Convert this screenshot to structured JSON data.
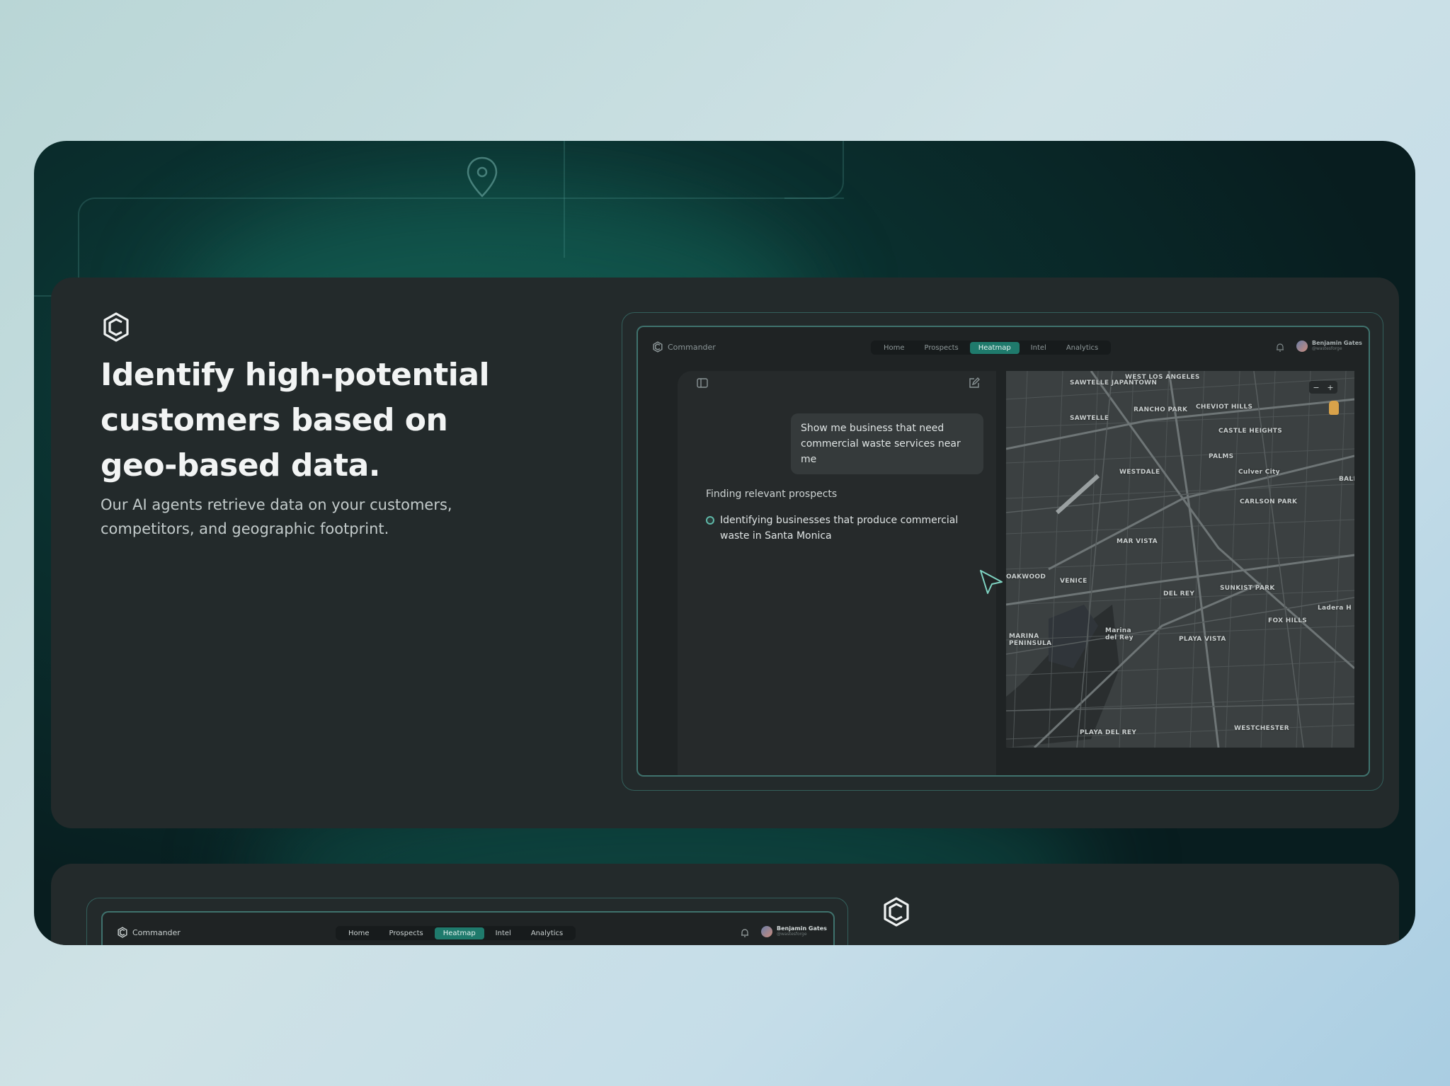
{
  "hero": {
    "headline": "Identify high-potential customers based on geo-based data.",
    "subtext": "Our AI agents retrieve data on your customers, competitors, and geographic footprint."
  },
  "app": {
    "brand": "Commander",
    "nav": [
      {
        "label": "Home",
        "active": false
      },
      {
        "label": "Prospects",
        "active": false
      },
      {
        "label": "Heatmap",
        "active": true
      },
      {
        "label": "Intel",
        "active": false
      },
      {
        "label": "Analytics",
        "active": false
      }
    ],
    "user": {
      "name": "Benjamin Gates",
      "handle": "@wastesforge"
    },
    "accent_color": "#1f7a6c"
  },
  "chat": {
    "user_message": "Show me business that need commercial waste services near me",
    "status_title": "Finding relevant prospects",
    "status_item": "Identifying businesses that produce commercial waste in Santa Monica"
  },
  "map": {
    "zoom_out": "−",
    "zoom_in": "+",
    "labels": [
      "SAWTELLE JAPANTOWN",
      "WEST LOS ANGELES",
      "RANCHO PARK",
      "CHEVIOT HILLS",
      "SAWTELLE",
      "CASTLE HEIGHTS",
      "PALMS",
      "WESTDALE",
      "Culver City",
      "CARLSON PARK",
      "MAR VISTA",
      "OAKWOOD",
      "VENICE",
      "DEL REY",
      "SUNKIST PARK",
      "FOX HILLS",
      "Ladera H",
      "MARINA PENINSULA",
      "Marina del Rey",
      "PLAYA VISTA",
      "PLAYA DEL REY",
      "WESTCHESTER",
      "BALD"
    ]
  },
  "second_card": {
    "brand": "Commander",
    "nav": [
      "Home",
      "Prospects",
      "Heatmap",
      "Intel",
      "Analytics"
    ],
    "active_nav": "Heatmap",
    "user_name": "Benjamin Gates",
    "user_handle": "@wastesforge"
  }
}
